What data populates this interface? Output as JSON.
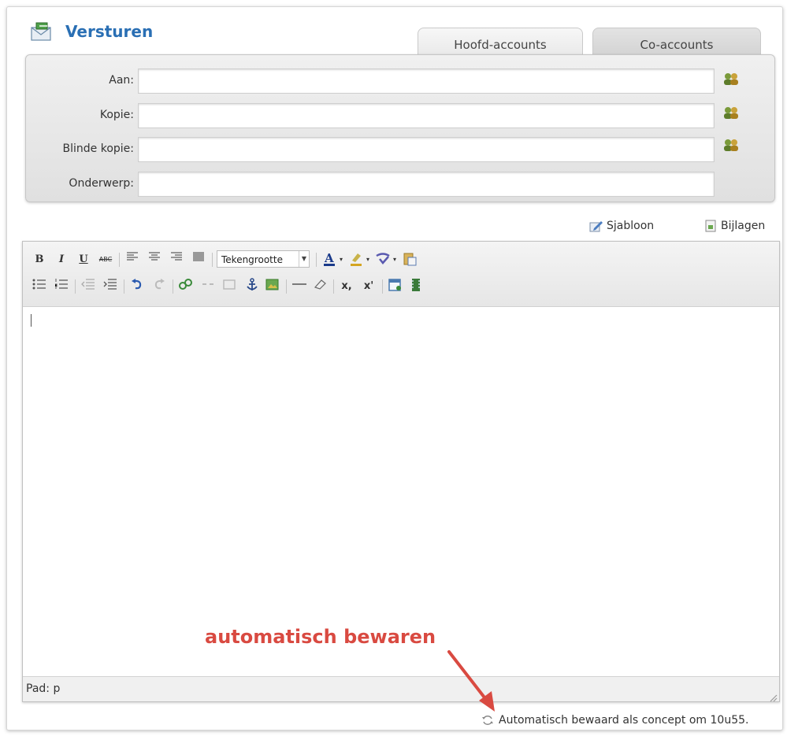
{
  "header": {
    "title": "Versturen",
    "icon": "envelope-icon"
  },
  "tabs": [
    {
      "label": "Hoofd-accounts",
      "active": true
    },
    {
      "label": "Co-accounts",
      "active": false
    }
  ],
  "fields": [
    {
      "label": "Aan:",
      "value": "",
      "has_contacts": true
    },
    {
      "label": "Kopie:",
      "value": "",
      "has_contacts": true
    },
    {
      "label": "Blinde kopie:",
      "value": "",
      "has_contacts": true
    },
    {
      "label": "Onderwerp:",
      "value": "",
      "has_contacts": false
    }
  ],
  "links": {
    "template": "Sjabloon",
    "attachments": "Bijlagen"
  },
  "toolbar": {
    "bold": "B",
    "italic": "I",
    "underline": "U",
    "strike": "ABC",
    "font_size": "Tekengrootte",
    "subscript": "x,",
    "superscript": "x'"
  },
  "editor": {
    "content": "",
    "path": "Pad: p"
  },
  "annotation": {
    "text": "automatisch bewaren",
    "color": "#d94a41"
  },
  "autosave": {
    "text": "Automatisch bewaard als concept om 10u55."
  },
  "colors": {
    "accent": "#2a6fb4",
    "annotation": "#d94a41"
  }
}
